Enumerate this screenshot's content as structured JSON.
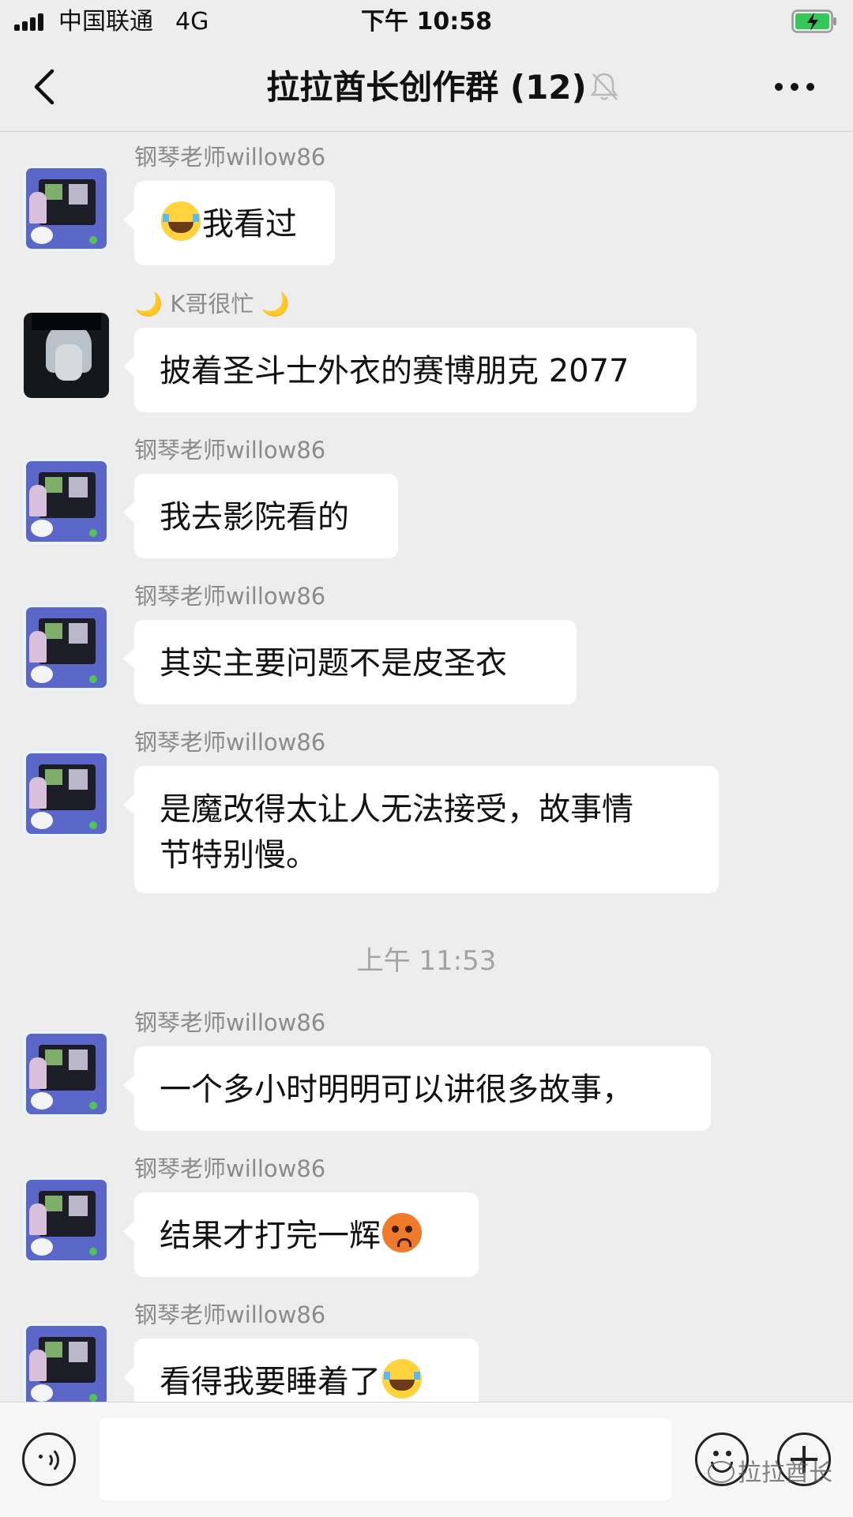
{
  "status_bar": {
    "carrier": "中国联通",
    "network": "4G",
    "time": "下午 10:58"
  },
  "nav": {
    "title": "拉拉酋长创作群 (12)",
    "icons": [
      "chevron-left-icon",
      "bell-muted-icon",
      "more-dots-icon"
    ]
  },
  "messages": [
    {
      "sender": "钢琴老师willow86",
      "avatar": "piano-teacher-avatar",
      "emoji_before": "laughing-tears-emoji",
      "text": "我看过"
    },
    {
      "sender": "🌙 K哥很忙 🌙",
      "avatar": "k-ge-avatar",
      "text": "披着圣斗士外衣的赛博朋克 2077"
    },
    {
      "sender": "钢琴老师willow86",
      "avatar": "piano-teacher-avatar",
      "text": "我去影院看的"
    },
    {
      "sender": "钢琴老师willow86",
      "avatar": "piano-teacher-avatar",
      "text": "其实主要问题不是皮圣衣"
    },
    {
      "sender": "钢琴老师willow86",
      "avatar": "piano-teacher-avatar",
      "text_line1": "是魔改得太让人无法接受，故事情",
      "text_line2": "节特别慢。"
    },
    {
      "sender": "钢琴老师willow86",
      "avatar": "piano-teacher-avatar",
      "text": "一个多小时明明可以讲很多故事，"
    },
    {
      "sender": "钢琴老师willow86",
      "avatar": "piano-teacher-avatar",
      "text": "结果才打完一辉",
      "emoji_after": "flushed-sweat-emoji"
    },
    {
      "sender": "钢琴老师willow86",
      "avatar": "piano-teacher-avatar",
      "text": "看得我要睡着了",
      "emoji_after": "laughing-tears-emoji"
    }
  ],
  "time_divider": "上午 11:53",
  "input_bar": {
    "placeholder": "",
    "icons": [
      "voice-icon",
      "emoji-face-icon",
      "plus-icon"
    ]
  },
  "watermark": "拉拉酋长"
}
